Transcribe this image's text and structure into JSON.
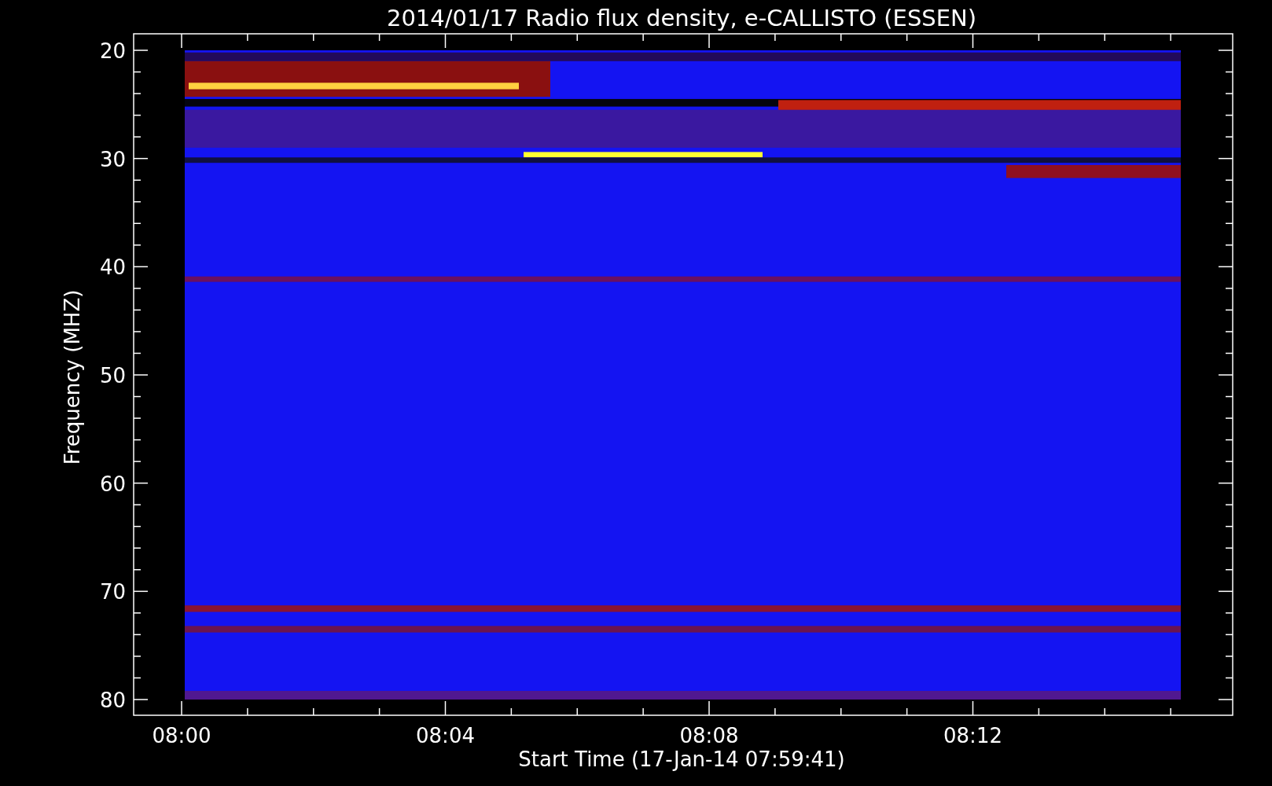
{
  "plot": {
    "title": "2014/01/17  Radio flux density, e-CALLISTO (ESSEN)",
    "ylabel": "Frequency (MHZ)",
    "xlabel": "Start Time (17-Jan-14 07:59:41)",
    "yticks": [
      "20",
      "30",
      "40",
      "50",
      "60",
      "70",
      "80"
    ],
    "xticks": [
      "08:00",
      "08:04",
      "08:08",
      "08:12"
    ]
  }
}
